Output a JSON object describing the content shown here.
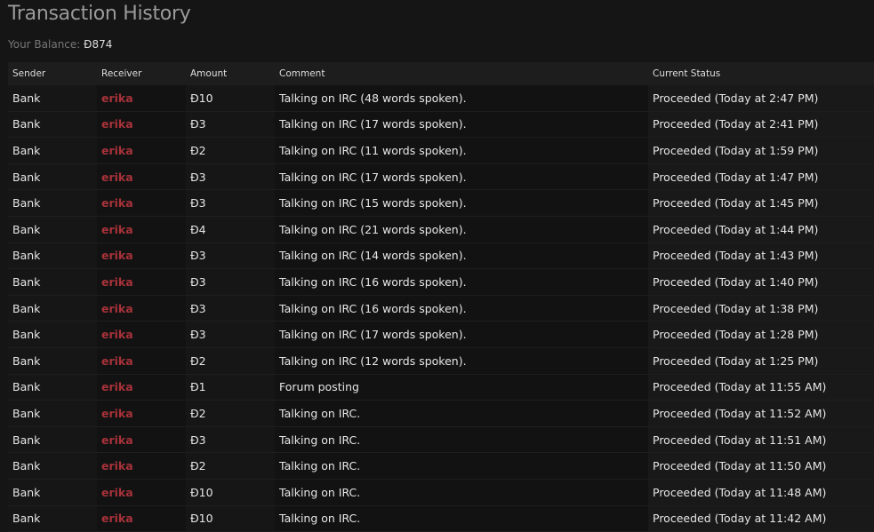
{
  "title": "Transaction History",
  "balance_label": "Your Balance:",
  "balance": "Đ874",
  "headers": [
    "Sender",
    "Receiver",
    "Amount",
    "Comment",
    "Current Status"
  ],
  "rows": [
    [
      "Bank",
      "erika",
      "Đ10",
      "Talking on IRC (48 words spoken).",
      "Proceeded (Today at 2:47 PM)"
    ],
    [
      "Bank",
      "erika",
      "Đ3",
      "Talking on IRC (17 words spoken).",
      "Proceeded (Today at 2:41 PM)"
    ],
    [
      "Bank",
      "erika",
      "Đ2",
      "Talking on IRC (11 words spoken).",
      "Proceeded (Today at 1:59 PM)"
    ],
    [
      "Bank",
      "erika",
      "Đ3",
      "Talking on IRC (17 words spoken).",
      "Proceeded (Today at 1:47 PM)"
    ],
    [
      "Bank",
      "erika",
      "Đ3",
      "Talking on IRC (15 words spoken).",
      "Proceeded (Today at 1:45 PM)"
    ],
    [
      "Bank",
      "erika",
      "Đ4",
      "Talking on IRC (21 words spoken).",
      "Proceeded (Today at 1:44 PM)"
    ],
    [
      "Bank",
      "erika",
      "Đ3",
      "Talking on IRC (14 words spoken).",
      "Proceeded (Today at 1:43 PM)"
    ],
    [
      "Bank",
      "erika",
      "Đ3",
      "Talking on IRC (16 words spoken).",
      "Proceeded (Today at 1:40 PM)"
    ],
    [
      "Bank",
      "erika",
      "Đ3",
      "Talking on IRC (16 words spoken).",
      "Proceeded (Today at 1:38 PM)"
    ],
    [
      "Bank",
      "erika",
      "Đ3",
      "Talking on IRC (17 words spoken).",
      "Proceeded (Today at 1:28 PM)"
    ],
    [
      "Bank",
      "erika",
      "Đ2",
      "Talking on IRC (12 words spoken).",
      "Proceeded (Today at 1:25 PM)"
    ],
    [
      "Bank",
      "erika",
      "Đ1",
      "Forum posting",
      "Proceeded (Today at 11:55 AM)"
    ],
    [
      "Bank",
      "erika",
      "Đ2",
      "Talking on IRC.",
      "Proceeded (Today at 11:52 AM)"
    ],
    [
      "Bank",
      "erika",
      "Đ3",
      "Talking on IRC.",
      "Proceeded (Today at 11:51 AM)"
    ],
    [
      "Bank",
      "erika",
      "Đ2",
      "Talking on IRC.",
      "Proceeded (Today at 11:50 AM)"
    ],
    [
      "Bank",
      "erika",
      "Đ10",
      "Talking on IRC.",
      "Proceeded (Today at 11:48 AM)"
    ],
    [
      "Bank",
      "erika",
      "Đ10",
      "Talking on IRC.",
      "Proceeded (Today at 11:42 AM)"
    ]
  ]
}
